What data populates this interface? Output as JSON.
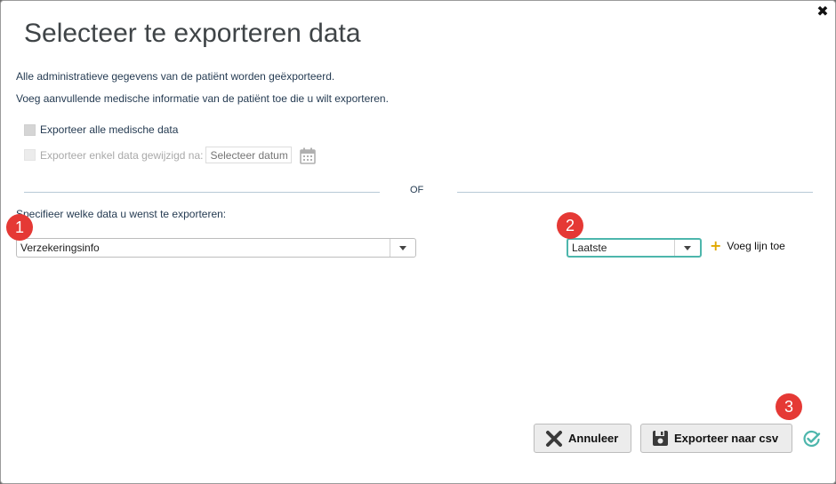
{
  "dialog": {
    "title": "Selecteer te exporteren data",
    "close_icon": "close-icon",
    "info_line1": "Alle administratieve gegevens van de patiënt worden geëxporteerd.",
    "info_line2": "Voeg aanvullende medische informatie van de patiënt toe die u wilt exporteren."
  },
  "options": {
    "export_all_label": "Exporteer alle medische data",
    "export_changed_label": "Exporteer enkel data gewijzigd na:",
    "date_placeholder": "Selecteer datum",
    "calendar_icon": "calendar-icon"
  },
  "separator": {
    "label": "OF"
  },
  "specify": {
    "label": "Specifieer welke data u wenst te exporteren:",
    "data_select_value": "Verzekeringsinfo",
    "scope_select_value": "Laatste",
    "add_line_label": "Voeg lijn toe"
  },
  "badges": [
    "1",
    "2",
    "3"
  ],
  "footer": {
    "cancel_label": "Annuleer",
    "export_label": "Exporteer naar csv"
  },
  "colors": {
    "badge": "#e53935",
    "focus": "#4db6ac",
    "text": "#253b52",
    "plus": "#e0a800"
  }
}
